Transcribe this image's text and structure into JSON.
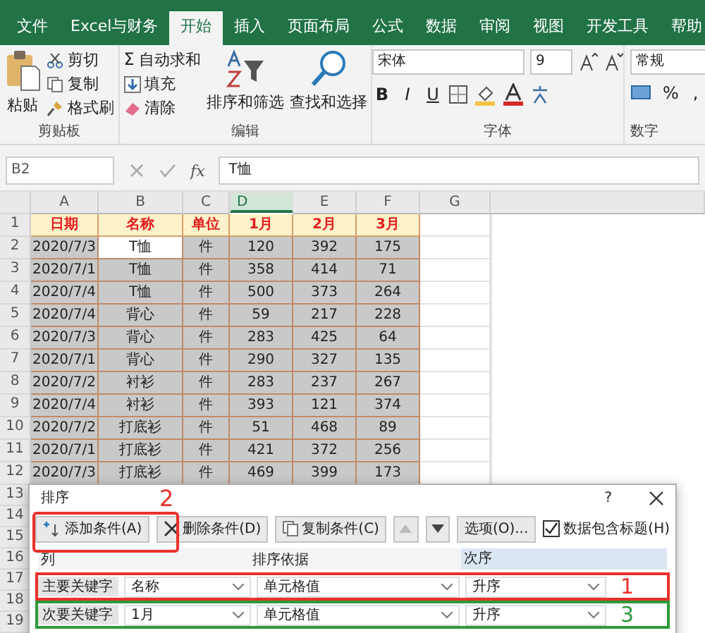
{
  "tabs": [
    {
      "label": "文件",
      "selected": false
    },
    {
      "label": "Excel与财务",
      "selected": false
    },
    {
      "label": "开始",
      "selected": true
    },
    {
      "label": "插入",
      "selected": false
    },
    {
      "label": "页面布局",
      "selected": false
    },
    {
      "label": "公式",
      "selected": false
    },
    {
      "label": "数据",
      "selected": false
    },
    {
      "label": "审阅",
      "selected": false
    },
    {
      "label": "视图",
      "selected": false
    },
    {
      "label": "开发工具",
      "selected": false
    },
    {
      "label": "帮助",
      "selected": false
    }
  ],
  "ribbon": {
    "clipboard": {
      "title": "剪贴板",
      "paste": "粘贴",
      "cut": "剪切",
      "copy": "复制",
      "format_painter": "格式刷"
    },
    "editing": {
      "title": "编辑",
      "autosum_symbol": "Σ",
      "autosum": "自动求和",
      "fill": "填充",
      "clear": "清除",
      "sort_filter": "排序和筛选",
      "find_select": "查找和选择"
    },
    "font": {
      "title": "字体",
      "font_name": "宋体",
      "font_size": "9",
      "bold": "B",
      "italic": "I",
      "underline": "U"
    },
    "number": {
      "title": "数字",
      "format": "常规",
      "percent": "%",
      "comma": ","
    }
  },
  "formula_bar": {
    "name_box": "B2",
    "function_label": "fx",
    "value": "T恤"
  },
  "sheet": {
    "columns": [
      {
        "label": "A",
        "selected": false
      },
      {
        "label": "B",
        "selected": false
      },
      {
        "label": "C",
        "selected": false
      },
      {
        "label": "D",
        "selected": true
      },
      {
        "label": "E",
        "selected": false
      },
      {
        "label": "F",
        "selected": false
      },
      {
        "label": "G",
        "selected": false
      }
    ],
    "header_row": {
      "number": "1",
      "cells": [
        "日期",
        "名称",
        "单位",
        "1月",
        "2月",
        "3月"
      ]
    },
    "rows": [
      {
        "number": "2",
        "cells": [
          "2020/7/3",
          "T恤",
          "件",
          "120",
          "392",
          "175"
        ]
      },
      {
        "number": "3",
        "cells": [
          "2020/7/1",
          "T恤",
          "件",
          "358",
          "414",
          "71"
        ]
      },
      {
        "number": "4",
        "cells": [
          "2020/7/4",
          "T恤",
          "件",
          "500",
          "373",
          "264"
        ]
      },
      {
        "number": "5",
        "cells": [
          "2020/7/4",
          "背心",
          "件",
          "59",
          "217",
          "228"
        ]
      },
      {
        "number": "6",
        "cells": [
          "2020/7/3",
          "背心",
          "件",
          "283",
          "425",
          "64"
        ]
      },
      {
        "number": "7",
        "cells": [
          "2020/7/1",
          "背心",
          "件",
          "290",
          "327",
          "135"
        ]
      },
      {
        "number": "8",
        "cells": [
          "2020/7/2",
          "衬衫",
          "件",
          "283",
          "237",
          "267"
        ]
      },
      {
        "number": "9",
        "cells": [
          "2020/7/4",
          "衬衫",
          "件",
          "393",
          "121",
          "374"
        ]
      },
      {
        "number": "10",
        "cells": [
          "2020/7/2",
          "打底衫",
          "件",
          "51",
          "468",
          "89"
        ]
      },
      {
        "number": "11",
        "cells": [
          "2020/7/1",
          "打底衫",
          "件",
          "421",
          "372",
          "256"
        ]
      },
      {
        "number": "12",
        "cells": [
          "2020/7/3",
          "打底衫",
          "件",
          "469",
          "399",
          "173"
        ]
      }
    ],
    "hidden_row_numbers": [
      "13",
      "14",
      "15",
      "16",
      "17",
      "18",
      "19"
    ]
  },
  "dialog": {
    "title": "排序",
    "help": "?",
    "toolbar": [
      {
        "kind": "add",
        "label": "添加条件(A)",
        "disabled": false
      },
      {
        "kind": "delete",
        "label": "删除条件(D)",
        "disabled": false
      },
      {
        "kind": "copy",
        "label": "复制条件(C)",
        "disabled": false
      },
      {
        "kind": "up",
        "disabled": true
      },
      {
        "kind": "down",
        "disabled": false
      },
      {
        "kind": "options",
        "label": "选项(O)...",
        "disabled": false
      }
    ],
    "has_headers": {
      "label": "数据包含标题(H)",
      "checked": true
    },
    "columns": [
      "列",
      "排序依据",
      "次序"
    ],
    "levels": [
      {
        "label": "主要关键字",
        "column": "名称",
        "sort_on": "单元格值",
        "order": "升序",
        "color": "#e8312a",
        "annotation": "1"
      },
      {
        "label": "次要关键字",
        "column": "1月",
        "sort_on": "单元格值",
        "order": "升序",
        "color": "#2e9a3a",
        "annotation": "3"
      }
    ],
    "add_annotation": {
      "label": "2",
      "color": "#e8312a"
    }
  }
}
